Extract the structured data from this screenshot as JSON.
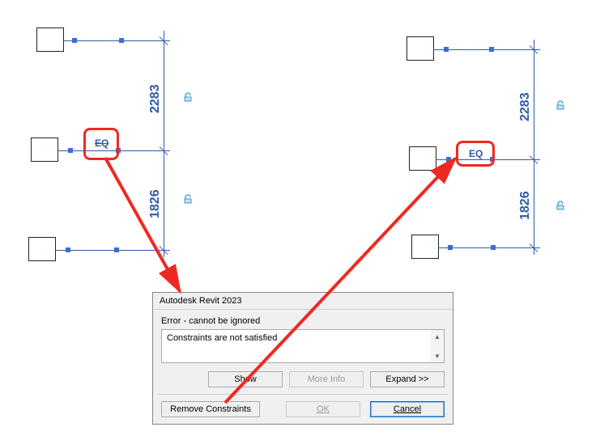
{
  "left": {
    "dim_top": "2283",
    "dim_bot": "1826",
    "eq": "EQ"
  },
  "right": {
    "dim_top": "2283",
    "dim_bot": "1826",
    "eq": "EQ"
  },
  "dialog": {
    "title": "Autodesk Revit 2023",
    "subtitle": "Error - cannot be ignored",
    "message": "Constraints are not satisfied",
    "btn_show": "Show",
    "btn_more": "More Info",
    "btn_expand": "Expand >>",
    "btn_remove": "Remove Constraints",
    "btn_ok": "OK",
    "btn_cancel": "Cancel"
  }
}
